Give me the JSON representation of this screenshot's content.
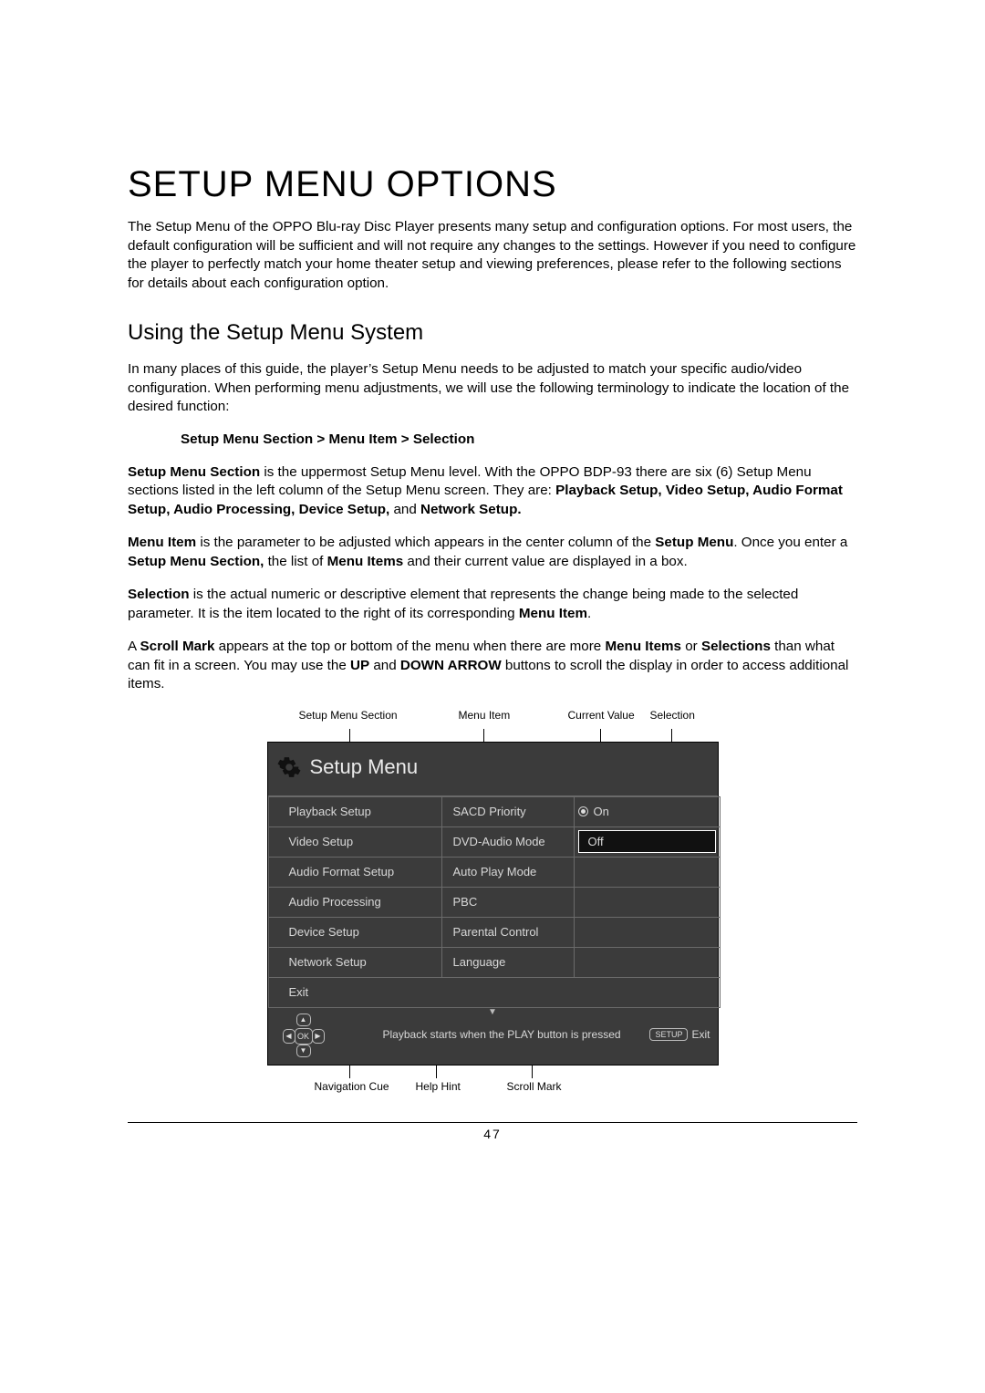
{
  "title": "SETUP MENU OPTIONS",
  "intro": "The Setup Menu of the OPPO Blu-ray Disc Player presents many setup and configuration options.  For most users, the default configuration will be sufficient and will not require any changes to the settings.  However if you need to configure the player to perfectly match your home theater setup and viewing preferences, please refer to the following sections for details about each configuration option.",
  "subtitle": "Using the Setup Menu System",
  "para1": "In many places of this guide, the player’s Setup Menu needs to be adjusted to match your specific audio/video configuration.  When performing menu adjustments, we will use the following terminology to indicate the location of the desired function:",
  "breadcrumb": "Setup Menu Section > Menu Item > Selection",
  "para2": {
    "a": "Setup Menu Section",
    "b": " is the uppermost Setup Menu level. With the OPPO BDP-93 there are six (6) Setup Menu sections listed in the left column of the Setup Menu screen.  They are: ",
    "c": "Playback Setup, Video Setup, Audio Format Setup, Audio Processing, Device Setup,",
    "d": " and ",
    "e": "Network Setup."
  },
  "para3": {
    "a": "Menu Item",
    "b": " is the parameter to be adjusted which appears in the center column of the ",
    "c": "Setup Menu",
    "d": ". Once you enter a ",
    "e": "Setup Menu Section,",
    "f": " the list of ",
    "g": "Menu Items",
    "h": " and their current value are displayed in a box."
  },
  "para4": {
    "a": "Selection",
    "b": " is the actual numeric or descriptive element that represents the change being made to the selected parameter.  It is the item located to the right of its corresponding ",
    "c": "Menu Item",
    "d": "."
  },
  "para5": {
    "a": "A ",
    "b": "Scroll Mark",
    "c": " appears at the top or bottom of the menu when there are more ",
    "d": "Menu Items",
    "e": " or ",
    "f": "Selections",
    "g": " than what can fit in a screen.  You may use the ",
    "h": "UP",
    "i": " and ",
    "j": "DOWN ARROW",
    "k": " buttons to scroll the display in order to access additional items."
  },
  "annot": {
    "top": {
      "section": "Setup Menu Section",
      "item": "Menu Item",
      "value": "Current Value",
      "selection": "Selection"
    },
    "bottom": {
      "nav": "Navigation Cue",
      "help": "Help Hint",
      "scroll": "Scroll Mark"
    }
  },
  "setup": {
    "header": "Setup Menu",
    "rows": [
      {
        "section": "Playback Setup",
        "item": "SACD Priority",
        "radio": true,
        "value": "On",
        "sel": ""
      },
      {
        "section": "Video Setup",
        "item": "DVD-Audio Mode",
        "radio": false,
        "value": "",
        "sel": "Off"
      },
      {
        "section": "Audio Format Setup",
        "item": "Auto Play Mode",
        "radio": false,
        "value": "",
        "sel": ""
      },
      {
        "section": "Audio Processing",
        "item": "PBC",
        "radio": false,
        "value": "",
        "sel": ""
      },
      {
        "section": "Device Setup",
        "item": "Parental Control",
        "radio": false,
        "value": "",
        "sel": ""
      },
      {
        "section": "Network Setup",
        "item": "Language",
        "radio": false,
        "value": "",
        "sel": ""
      },
      {
        "section": "Exit",
        "item": "",
        "radio": false,
        "value": "",
        "sel": ""
      }
    ],
    "hint": "Playback starts when the PLAY button is pressed",
    "setup_badge": "SETUP",
    "exit_label": "Exit",
    "ok": "OK"
  },
  "page_number": "47"
}
